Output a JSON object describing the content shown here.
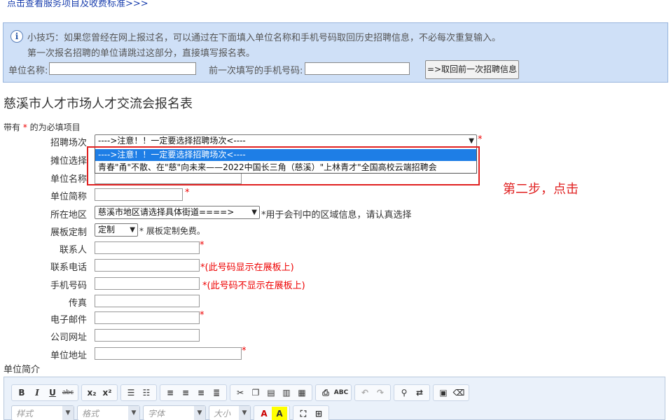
{
  "top_link": "点击查看服务项目及收费标准>>>",
  "tip": {
    "line1": "小技巧：如果您曾经在网上报过名，可以通过在下面填入单位名称和手机号码取回历史招聘信息，不必每次重复输入。",
    "line2": "第一次报名招聘的单位请跳过这部分，直接填写报名表。",
    "company_label": "单位名称:",
    "phone_label": "前一次填写的手机号码:",
    "retrieve_button": "=>取回前一次招聘信息"
  },
  "form": {
    "title": "慈溪市人才市场人才交流会报名表",
    "required_note_prefix": "带有",
    "required_note_star": "*",
    "required_note_suffix": "的为必填项目",
    "fields": {
      "session_label": "招聘场次",
      "session_selected": "---->注意！！一定要选择招聘场次<----",
      "booth_label": "摊位选择",
      "company_name_label": "单位名称",
      "short_name_label": "单位简称",
      "region_label": "所在地区",
      "region_selected": "慈溪市地区请选择具体街道====>",
      "region_note": "*用于会刊中的区域信息，请认真选择",
      "board_label": "展板定制",
      "board_selected": "定制",
      "board_note": "* 展板定制免费。",
      "contact_label": "联系人",
      "tel_label": "联系电话",
      "tel_note": "*(此号码显示在展板上)",
      "mobile_label": "手机号码",
      "mobile_note": "*(此号码不显示在展板上)",
      "fax_label": "传真",
      "email_label": "电子邮件",
      "website_label": "公司网址",
      "address_label": "单位地址",
      "star": "*"
    },
    "dropdown_options": [
      "---->注意！！一定要选择招聘场次<----",
      "青春\"甬\"不散、在\"慈\"向未来——2022中国长三角（慈溪）\"上林青才\"全国高校云端招聘会"
    ],
    "intro_label": "单位简介"
  },
  "annotation": "第二步，点击",
  "editor": {
    "row1": [
      "B",
      "I",
      "U",
      "abc",
      "x₂",
      "x²",
      "ol-icon",
      "ul-icon",
      "align-left-icon",
      "align-center-icon",
      "align-right-icon",
      "justify-icon",
      "cut-icon",
      "copy-icon",
      "paste-icon",
      "paste-text-icon",
      "paste-word-icon",
      "print-icon",
      "spellcheck-icon",
      "undo-icon",
      "redo-icon",
      "find-icon",
      "replace-icon",
      "select-all-icon",
      "remove-format-icon"
    ],
    "style_placeholder": "样式",
    "format_placeholder": "格式",
    "font_placeholder": "字体",
    "size_placeholder": "大小"
  }
}
